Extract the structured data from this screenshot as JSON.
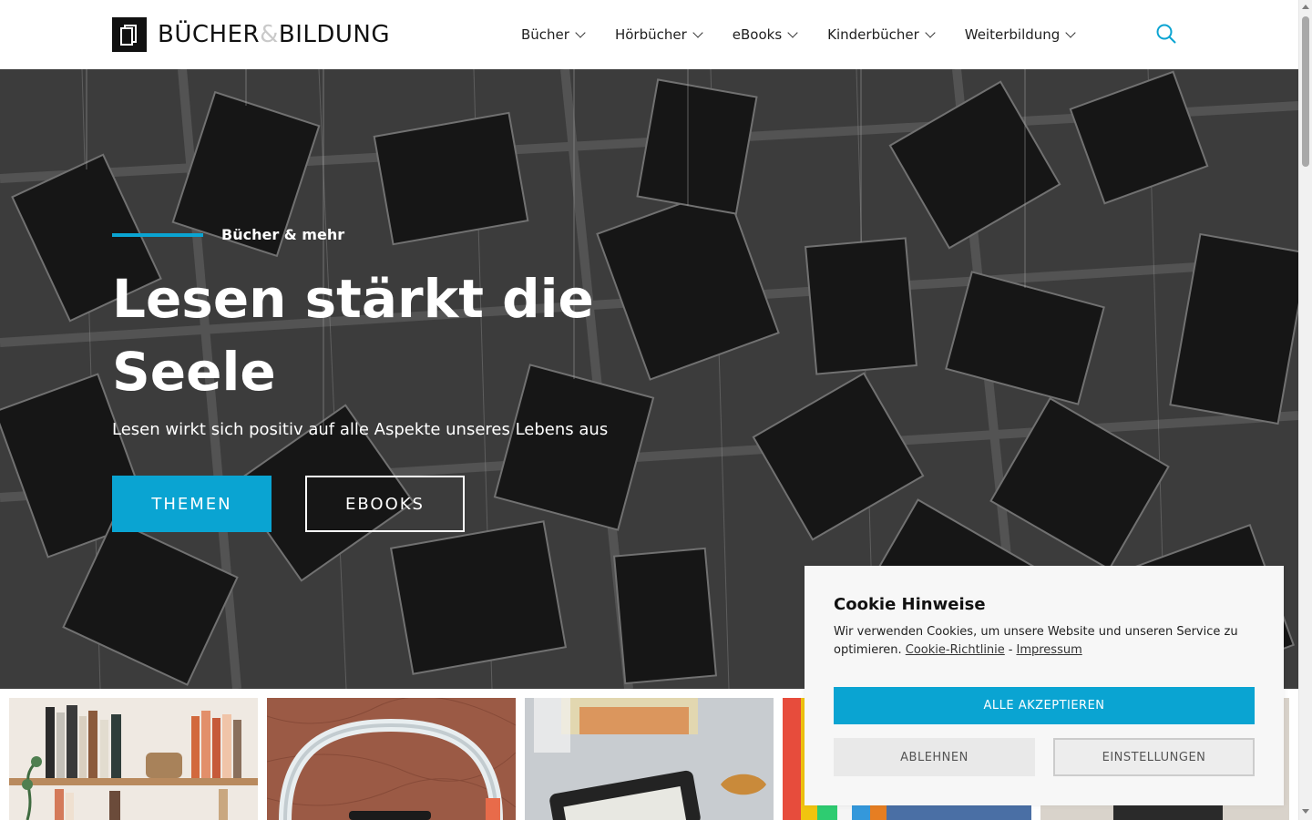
{
  "colors": {
    "accent": "#0aa4d2",
    "header_bg": "#ffffff",
    "cookie_bg": "#f7f7f7",
    "text_dark": "#111111"
  },
  "brand": {
    "word1": "BÜCHER",
    "amp": "&",
    "word2": "BILDUNG",
    "logo_icon": "book-logo-icon"
  },
  "nav": {
    "items": [
      {
        "label": "Bücher",
        "icon": "chevron-down-icon"
      },
      {
        "label": "Hörbücher",
        "icon": "chevron-down-icon"
      },
      {
        "label": "eBooks",
        "icon": "chevron-down-icon"
      },
      {
        "label": "Kinderbücher",
        "icon": "chevron-down-icon"
      },
      {
        "label": "Weiterbildung",
        "icon": "chevron-down-icon"
      }
    ],
    "search_icon": "search-icon"
  },
  "hero": {
    "eyebrow": "Bücher & mehr",
    "title": "Lesen stärkt die Seele",
    "subtitle": "Lesen wirkt sich positiv auf alle Aspekte unseres Lebens aus",
    "primary_button": "THEMEN",
    "secondary_button": "EBOOKS"
  },
  "cookie": {
    "title": "Cookie Hinweise",
    "text": "Wir verwenden Cookies, um unsere Website und unseren Service zu optimieren.",
    "link_policy": "Cookie-Richtlinie",
    "separator": "-",
    "link_imprint": "Impressum",
    "accept": "ALLE AKZEPTIEREN",
    "reject": "ABLEHNEN",
    "settings": "EINSTELLUNGEN"
  }
}
